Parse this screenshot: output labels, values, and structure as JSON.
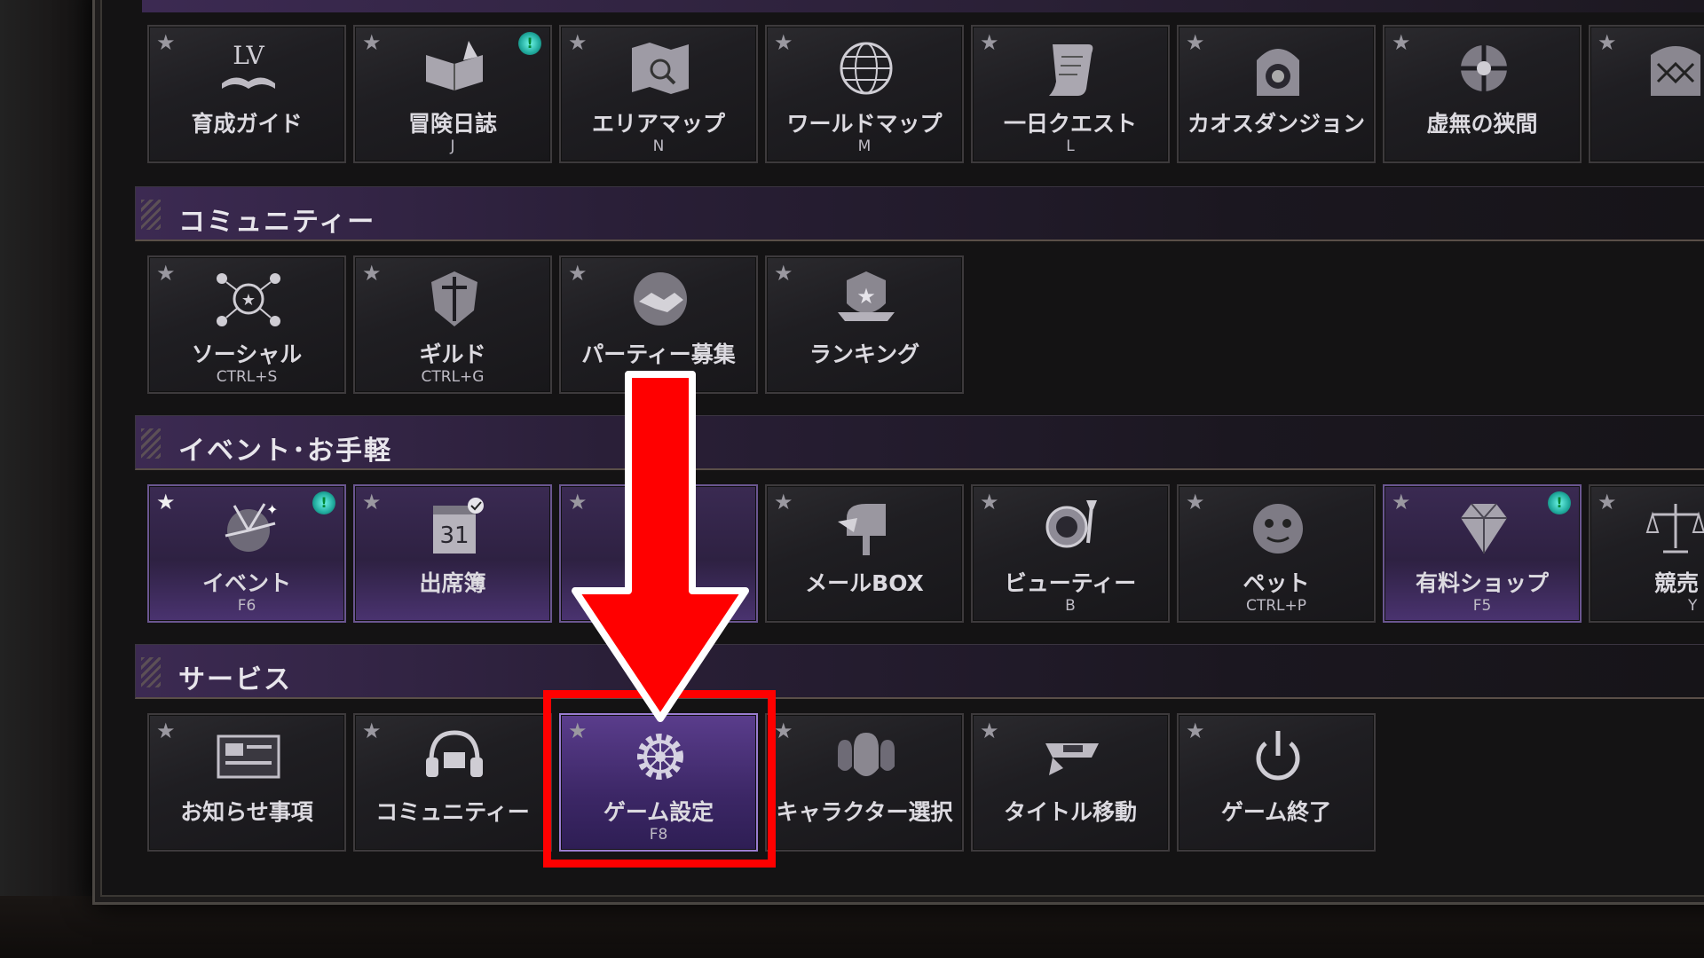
{
  "sections": {
    "community": "コミュニティー",
    "event": "イベント･お手軽",
    "service": "サービス"
  },
  "row1": [
    {
      "label": "育成ガイド",
      "key": "",
      "icon": "lv-book-icon"
    },
    {
      "label": "冒険日誌",
      "key": "J",
      "icon": "journal-icon",
      "badge": "!"
    },
    {
      "label": "エリアマップ",
      "key": "N",
      "icon": "area-map-icon"
    },
    {
      "label": "ワールドマップ",
      "key": "M",
      "icon": "globe-icon"
    },
    {
      "label": "一日クエスト",
      "key": "L",
      "icon": "scroll-icon"
    },
    {
      "label": "カオスダンジョン",
      "key": "",
      "icon": "chaos-gate-icon"
    },
    {
      "label": "虚無の狭間",
      "key": "",
      "icon": "void-rift-icon"
    }
  ],
  "community": [
    {
      "label": "ソーシャル",
      "key": "CTRL+S",
      "icon": "social-network-icon"
    },
    {
      "label": "ギルド",
      "key": "CTRL+G",
      "icon": "guild-crest-icon"
    },
    {
      "label": "パーティー募集",
      "key": "",
      "icon": "handshake-icon"
    },
    {
      "label": "ランキング",
      "key": "",
      "icon": "ranking-badge-icon"
    }
  ],
  "event": [
    {
      "label": "イベント",
      "key": "F6",
      "icon": "fireworks-icon",
      "badge": "!"
    },
    {
      "label": "出席簿",
      "key": "",
      "icon": "calendar-icon",
      "calendar_day": "31"
    },
    {
      "label": "メールBOX",
      "key": "",
      "icon": "mailbox-icon"
    },
    {
      "label": "ビューティー",
      "key": "B",
      "icon": "mirror-brush-icon"
    },
    {
      "label": "ペット",
      "key": "CTRL+P",
      "icon": "pet-icon"
    },
    {
      "label": "有料ショップ",
      "key": "F5",
      "icon": "diamond-icon",
      "badge": "!"
    },
    {
      "label": "競売",
      "key": "Y",
      "icon": "scales-icon"
    }
  ],
  "service": [
    {
      "label": "お知らせ事項",
      "key": "",
      "icon": "notice-board-icon"
    },
    {
      "label": "コミュニティー",
      "key": "",
      "icon": "headset-icon"
    },
    {
      "label": "ゲーム設定",
      "key": "F8",
      "icon": "gear-icon"
    },
    {
      "label": "キャラクター選択",
      "key": "",
      "icon": "characters-icon"
    },
    {
      "label": "タイトル移動",
      "key": "",
      "icon": "title-sign-icon"
    },
    {
      "label": "ゲーム終了",
      "key": "",
      "icon": "power-icon"
    }
  ],
  "colors": {
    "highlight": "#ff0000",
    "accent_purple": "#5a3d8c",
    "badge": "#1fa99c"
  }
}
